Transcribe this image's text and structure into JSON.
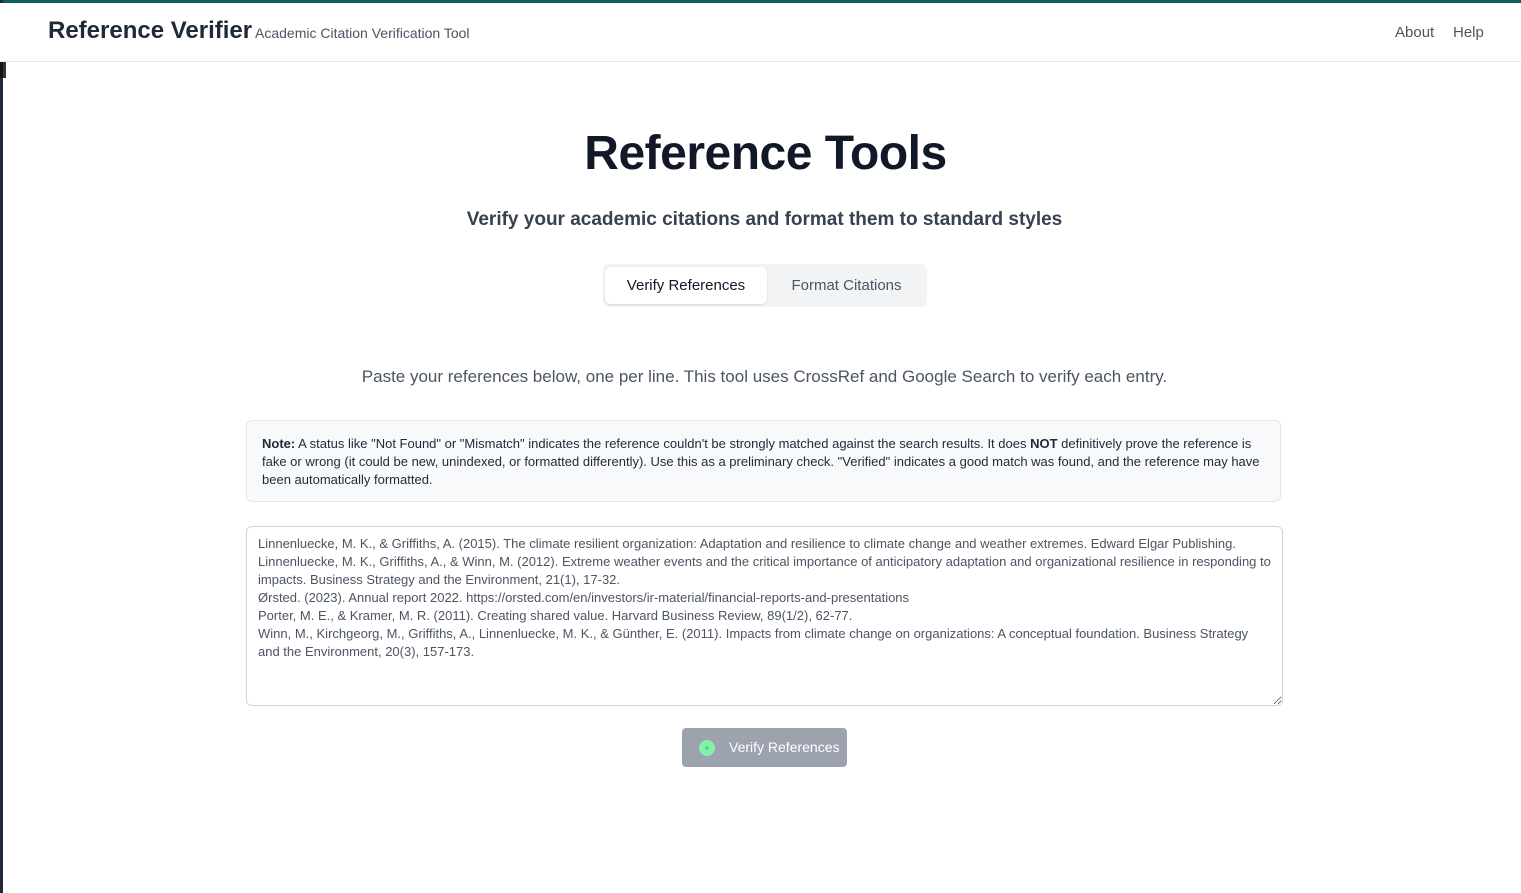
{
  "colors": {
    "accent_border": "#0f5f5f",
    "button_bg": "#9ca3af",
    "spinner": "#86efac"
  },
  "header": {
    "brand": "Reference Verifier",
    "tagline": "Academic Citation Verification Tool",
    "nav": [
      {
        "label": "About"
      },
      {
        "label": "Help"
      }
    ]
  },
  "main": {
    "title": "Reference Tools",
    "subtitle": "Verify your academic citations and format them to standard styles",
    "tabs": [
      {
        "label": "Verify References",
        "active": true
      },
      {
        "label": "Format Citations",
        "active": false
      }
    ],
    "instructions": "Paste your references below, one per line. This tool uses CrossRef and Google Search to verify each entry.",
    "note": {
      "label": "Note:",
      "text_before": " A status like \"Not Found\" or \"Mismatch\" indicates the reference couldn't be strongly matched against the search results. It does ",
      "emphasis": "NOT",
      "text_after": " definitively prove the reference is fake or wrong (it could be new, unindexed, or formatted differently). Use this as a preliminary check. \"Verified\" indicates a good match was found, and the reference may have been automatically formatted."
    },
    "references_value": "Linnenluecke, M. K., & Griffiths, A. (2015). The climate resilient organization: Adaptation and resilience to climate change and weather extremes. Edward Elgar Publishing.\nLinnenluecke, M. K., Griffiths, A., & Winn, M. (2012). Extreme weather events and the critical importance of anticipatory adaptation and organizational resilience in responding to impacts. Business Strategy and the Environment, 21(1), 17-32.\nØrsted. (2023). Annual report 2022. https://orsted.com/en/investors/ir-material/financial-reports-and-presentations\nPorter, M. E., & Kramer, M. R. (2011). Creating shared value. Harvard Business Review, 89(1/2), 62-77.\nWinn, M., Kirchgeorg, M., Griffiths, A., Linnenluecke, M. K., & Günther, E. (2011). Impacts from climate change on organizations: A conceptual foundation. Business Strategy and the Environment, 20(3), 157-173.",
    "verify_button": {
      "label": "Verify References",
      "icon": "loading-spinner-icon"
    }
  }
}
